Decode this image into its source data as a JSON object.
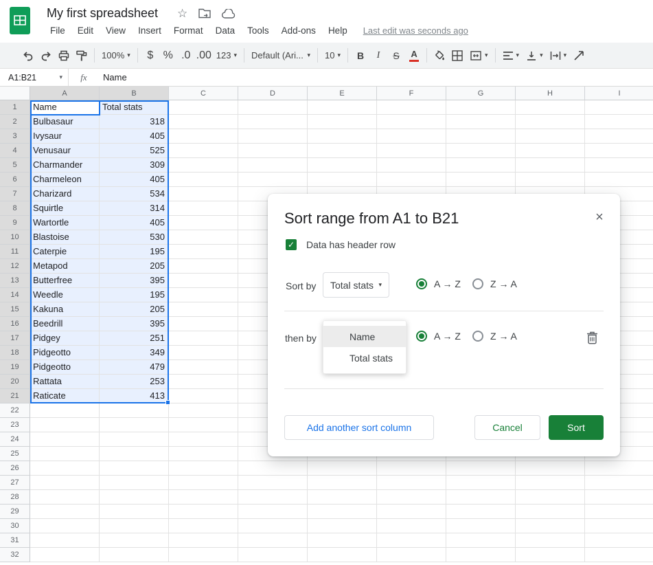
{
  "titlebar": {
    "title": "My first spreadsheet"
  },
  "menus": [
    "File",
    "Edit",
    "View",
    "Insert",
    "Format",
    "Data",
    "Tools",
    "Add-ons",
    "Help"
  ],
  "last_edit": "Last edit was seconds ago",
  "toolbar": {
    "zoom": "100%",
    "currency": "$",
    "percent": "%",
    "decimal_decrease": ".0",
    "decimal_increase": ".00",
    "more_formats": "123",
    "font_name": "Default (Ari...",
    "font_size": "10",
    "bold": "B",
    "italic": "I",
    "strikethrough": "S",
    "text_color": "A"
  },
  "formula_bar": {
    "name_box": "A1:B21",
    "fx": "fx",
    "content": "Name"
  },
  "grid": {
    "columns": [
      "A",
      "B",
      "C",
      "D",
      "E",
      "F",
      "G",
      "H",
      "I"
    ],
    "visible_rows": 32,
    "selected_range": "A1:B21",
    "rows_data": [
      [
        "Name",
        "Total stats"
      ],
      [
        "Bulbasaur",
        "318"
      ],
      [
        "Ivysaur",
        "405"
      ],
      [
        "Venusaur",
        "525"
      ],
      [
        "Charmander",
        "309"
      ],
      [
        "Charmeleon",
        "405"
      ],
      [
        "Charizard",
        "534"
      ],
      [
        "Squirtle",
        "314"
      ],
      [
        "Wartortle",
        "405"
      ],
      [
        "Blastoise",
        "530"
      ],
      [
        "Caterpie",
        "195"
      ],
      [
        "Metapod",
        "205"
      ],
      [
        "Butterfree",
        "395"
      ],
      [
        "Weedle",
        "195"
      ],
      [
        "Kakuna",
        "205"
      ],
      [
        "Beedrill",
        "395"
      ],
      [
        "Pidgey",
        "251"
      ],
      [
        "Pidgeotto",
        "349"
      ],
      [
        "Pidgeotto",
        "479"
      ],
      [
        "Rattata",
        "253"
      ],
      [
        "Raticate",
        "413"
      ]
    ]
  },
  "dialog": {
    "title": "Sort range from A1 to B21",
    "header_checkbox_label": "Data has header row",
    "sort_by_label": "Sort by",
    "sort_by_value": "Total stats",
    "then_by_label": "then by",
    "radio_az": "A → Z",
    "radio_za": "Z → A",
    "dropdown_options": [
      "Name",
      "Total stats"
    ],
    "add_column_button": "Add another sort column",
    "cancel_button": "Cancel",
    "sort_button": "Sort"
  },
  "icons": {
    "dropdown_arrow": "▾",
    "star": "☆",
    "close": "×",
    "checkmark": "✓"
  },
  "colors": {
    "brand_green": "#0f9d58",
    "accent_green": "#188038",
    "accent_blue": "#1a73e8",
    "selection_fill": "#e8f0fe"
  }
}
